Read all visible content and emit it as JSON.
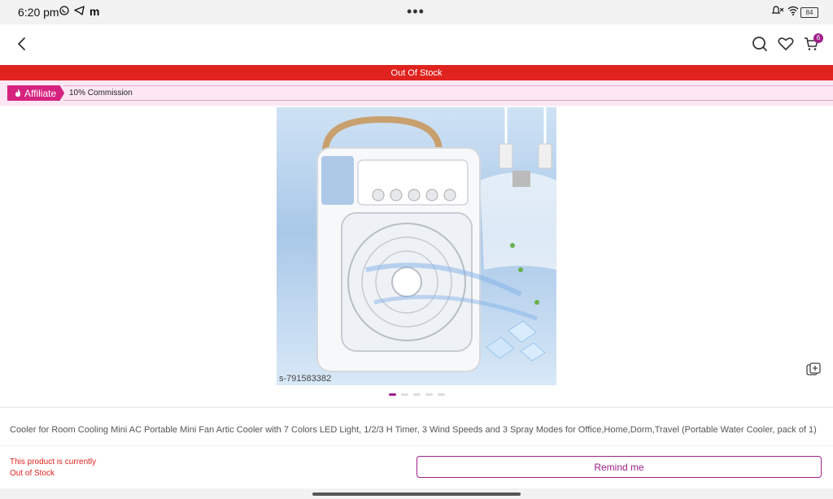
{
  "status_bar": {
    "time": "6:20 pm",
    "battery": "84"
  },
  "banner": {
    "text": "Out Of Stock",
    "color": "#e0231f"
  },
  "affiliate": {
    "tag": "Affiliate",
    "commission": "10% Commission",
    "color": "#d6237f"
  },
  "header": {
    "cart_count": "6"
  },
  "product": {
    "image_code": "s-791583382",
    "title": "Cooler for Room Cooling Mini AC Portable Mini Fan Artic Cooler with 7 Colors LED Light, 1/2/3 H Timer, 3 Wind Speeds and 3 Spray Modes for Office,Home,Dorm,Travel (Portable Water Cooler, pack of 1)",
    "image_count": 5,
    "active_image": 1
  },
  "bottom": {
    "stock_message_line1": "This product is currently",
    "stock_message_line2": "Out of Stock",
    "remind_button": "Remind me"
  },
  "colors": {
    "accent": "#9f2089",
    "alert": "#e0231f",
    "affiliate_bg": "#fde7f5"
  }
}
